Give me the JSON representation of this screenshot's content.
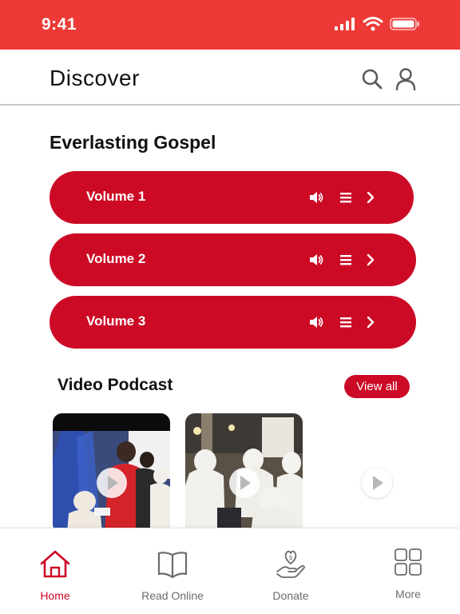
{
  "status_bar": {
    "time": "9:41"
  },
  "header": {
    "title": "Discover"
  },
  "everlasting": {
    "title": "Everlasting Gospel",
    "volumes": [
      {
        "label": "Volume 1"
      },
      {
        "label": "Volume 2"
      },
      {
        "label": "Volume 3"
      }
    ]
  },
  "video_podcast": {
    "title": "Video Podcast",
    "view_all_label": "View all"
  },
  "bottom_nav": {
    "items": [
      {
        "label": "Home",
        "icon": "home-icon"
      },
      {
        "label": "Read Online",
        "icon": "book-icon"
      },
      {
        "label": "Donate",
        "icon": "donate-icon"
      },
      {
        "label": "More",
        "icon": "grid-icon"
      }
    ]
  },
  "colors": {
    "accent": "#cc0a26",
    "status_bar": "#ee3a37"
  }
}
